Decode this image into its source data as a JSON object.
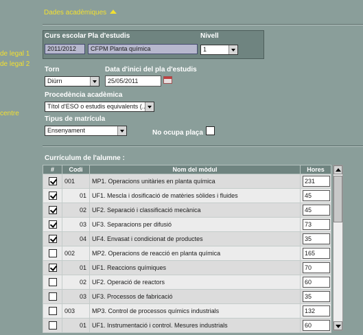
{
  "side_links": [
    "de legal 1",
    "de legal 2",
    "centre"
  ],
  "section": {
    "title": "Dades acadèmiques"
  },
  "study": {
    "course_label": "Curs escolar",
    "plan_label": "Pla d'estudis",
    "level_label": "Nivell",
    "course": "2011/2012",
    "plan": "CFPM Planta química",
    "level": "1"
  },
  "shift": {
    "label": "Torn",
    "value": "Diürn"
  },
  "start_date": {
    "label": "Data d'inici del pla d'estudis",
    "value": "25/05/2011"
  },
  "origin": {
    "label": "Procedència acadèmica",
    "value": "Títol d'ESO o estudis equivalents (..."
  },
  "enrollment": {
    "label": "Tipus de matrícula",
    "value": "Ensenyament"
  },
  "no_seat": {
    "label": "No ocupa plaça"
  },
  "curriculum": {
    "title": "Currículum de l'alumne :",
    "headers": {
      "check": "#",
      "code": "Codi",
      "name": "Nom del mòdul",
      "hours": "Hores"
    },
    "rows": [
      {
        "checked": true,
        "code": "001",
        "type": "mp",
        "name": "MP1. Operacions unitàries en planta química",
        "hours": "231"
      },
      {
        "checked": true,
        "code": "01",
        "type": "uf",
        "name": "UF1. Mescla i dosificació de matèries sòlides i fluides",
        "hours": "45"
      },
      {
        "checked": true,
        "code": "02",
        "type": "uf",
        "name": "UF2. Separació i classificació mecànica",
        "hours": "45"
      },
      {
        "checked": true,
        "code": "03",
        "type": "uf",
        "name": "UF3. Separacions per difusió",
        "hours": "73"
      },
      {
        "checked": true,
        "code": "04",
        "type": "uf",
        "name": "UF4. Envasat i condicionat de productes",
        "hours": "35"
      },
      {
        "checked": false,
        "code": "002",
        "type": "mp",
        "name": "MP2. Operacions de reacció en planta química",
        "hours": "165"
      },
      {
        "checked": true,
        "code": "01",
        "type": "uf",
        "name": "UF1. Reaccions químiques",
        "hours": "70"
      },
      {
        "checked": false,
        "code": "02",
        "type": "uf",
        "name": "UF2. Operació de reactors",
        "hours": "60"
      },
      {
        "checked": false,
        "code": "03",
        "type": "uf",
        "name": "UF3. Processos de fabricació",
        "hours": "35"
      },
      {
        "checked": false,
        "code": "003",
        "type": "mp",
        "name": "MP3. Control de processos químics industrials",
        "hours": "132"
      },
      {
        "checked": false,
        "code": "01",
        "type": "uf",
        "name": "UF1. Instrumentació i control. Mesures industrials",
        "hours": "60"
      }
    ]
  }
}
